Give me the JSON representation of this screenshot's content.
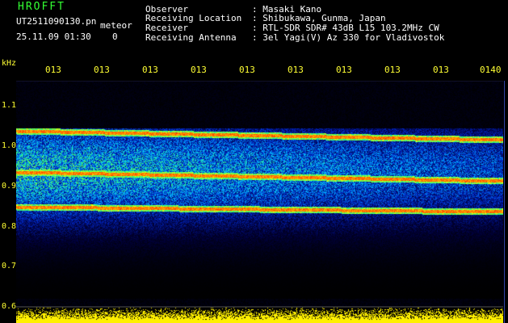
{
  "header": {
    "app_title": "HROFFT",
    "filename": "UT2511090130.pn",
    "mode": "meteor",
    "datetime": "25.11.09 01:30",
    "counter": "0",
    "observer_key": "Observer",
    "observer_val": ": Masaki Kano",
    "location_key": "Receiving Location",
    "location_val": ": Shibukawa, Gunma, Japan",
    "receiver_key": "Receiver",
    "receiver_val": ": RTL-SDR SDR# 43dB L15 103.2MHz CW",
    "antenna_key": "Receiving Antenna",
    "antenna_val": ": 3el Yagi(V) Az 330 for Vladivostok"
  },
  "axes": {
    "freq_unit": "kHz",
    "time_ticks": [
      "013",
      "013",
      "013",
      "013",
      "013",
      "013",
      "013",
      "013",
      "013",
      "0140"
    ],
    "freq_ticks": [
      "1.1",
      "1.0",
      "0.9",
      "0.8",
      "0.7",
      "0.6"
    ]
  },
  "colors": {
    "title": "#33ff33",
    "text": "#ffffff",
    "axis": "#ffff33",
    "signal_line": "#ff3333",
    "noise_floor": "#ffff00"
  }
}
